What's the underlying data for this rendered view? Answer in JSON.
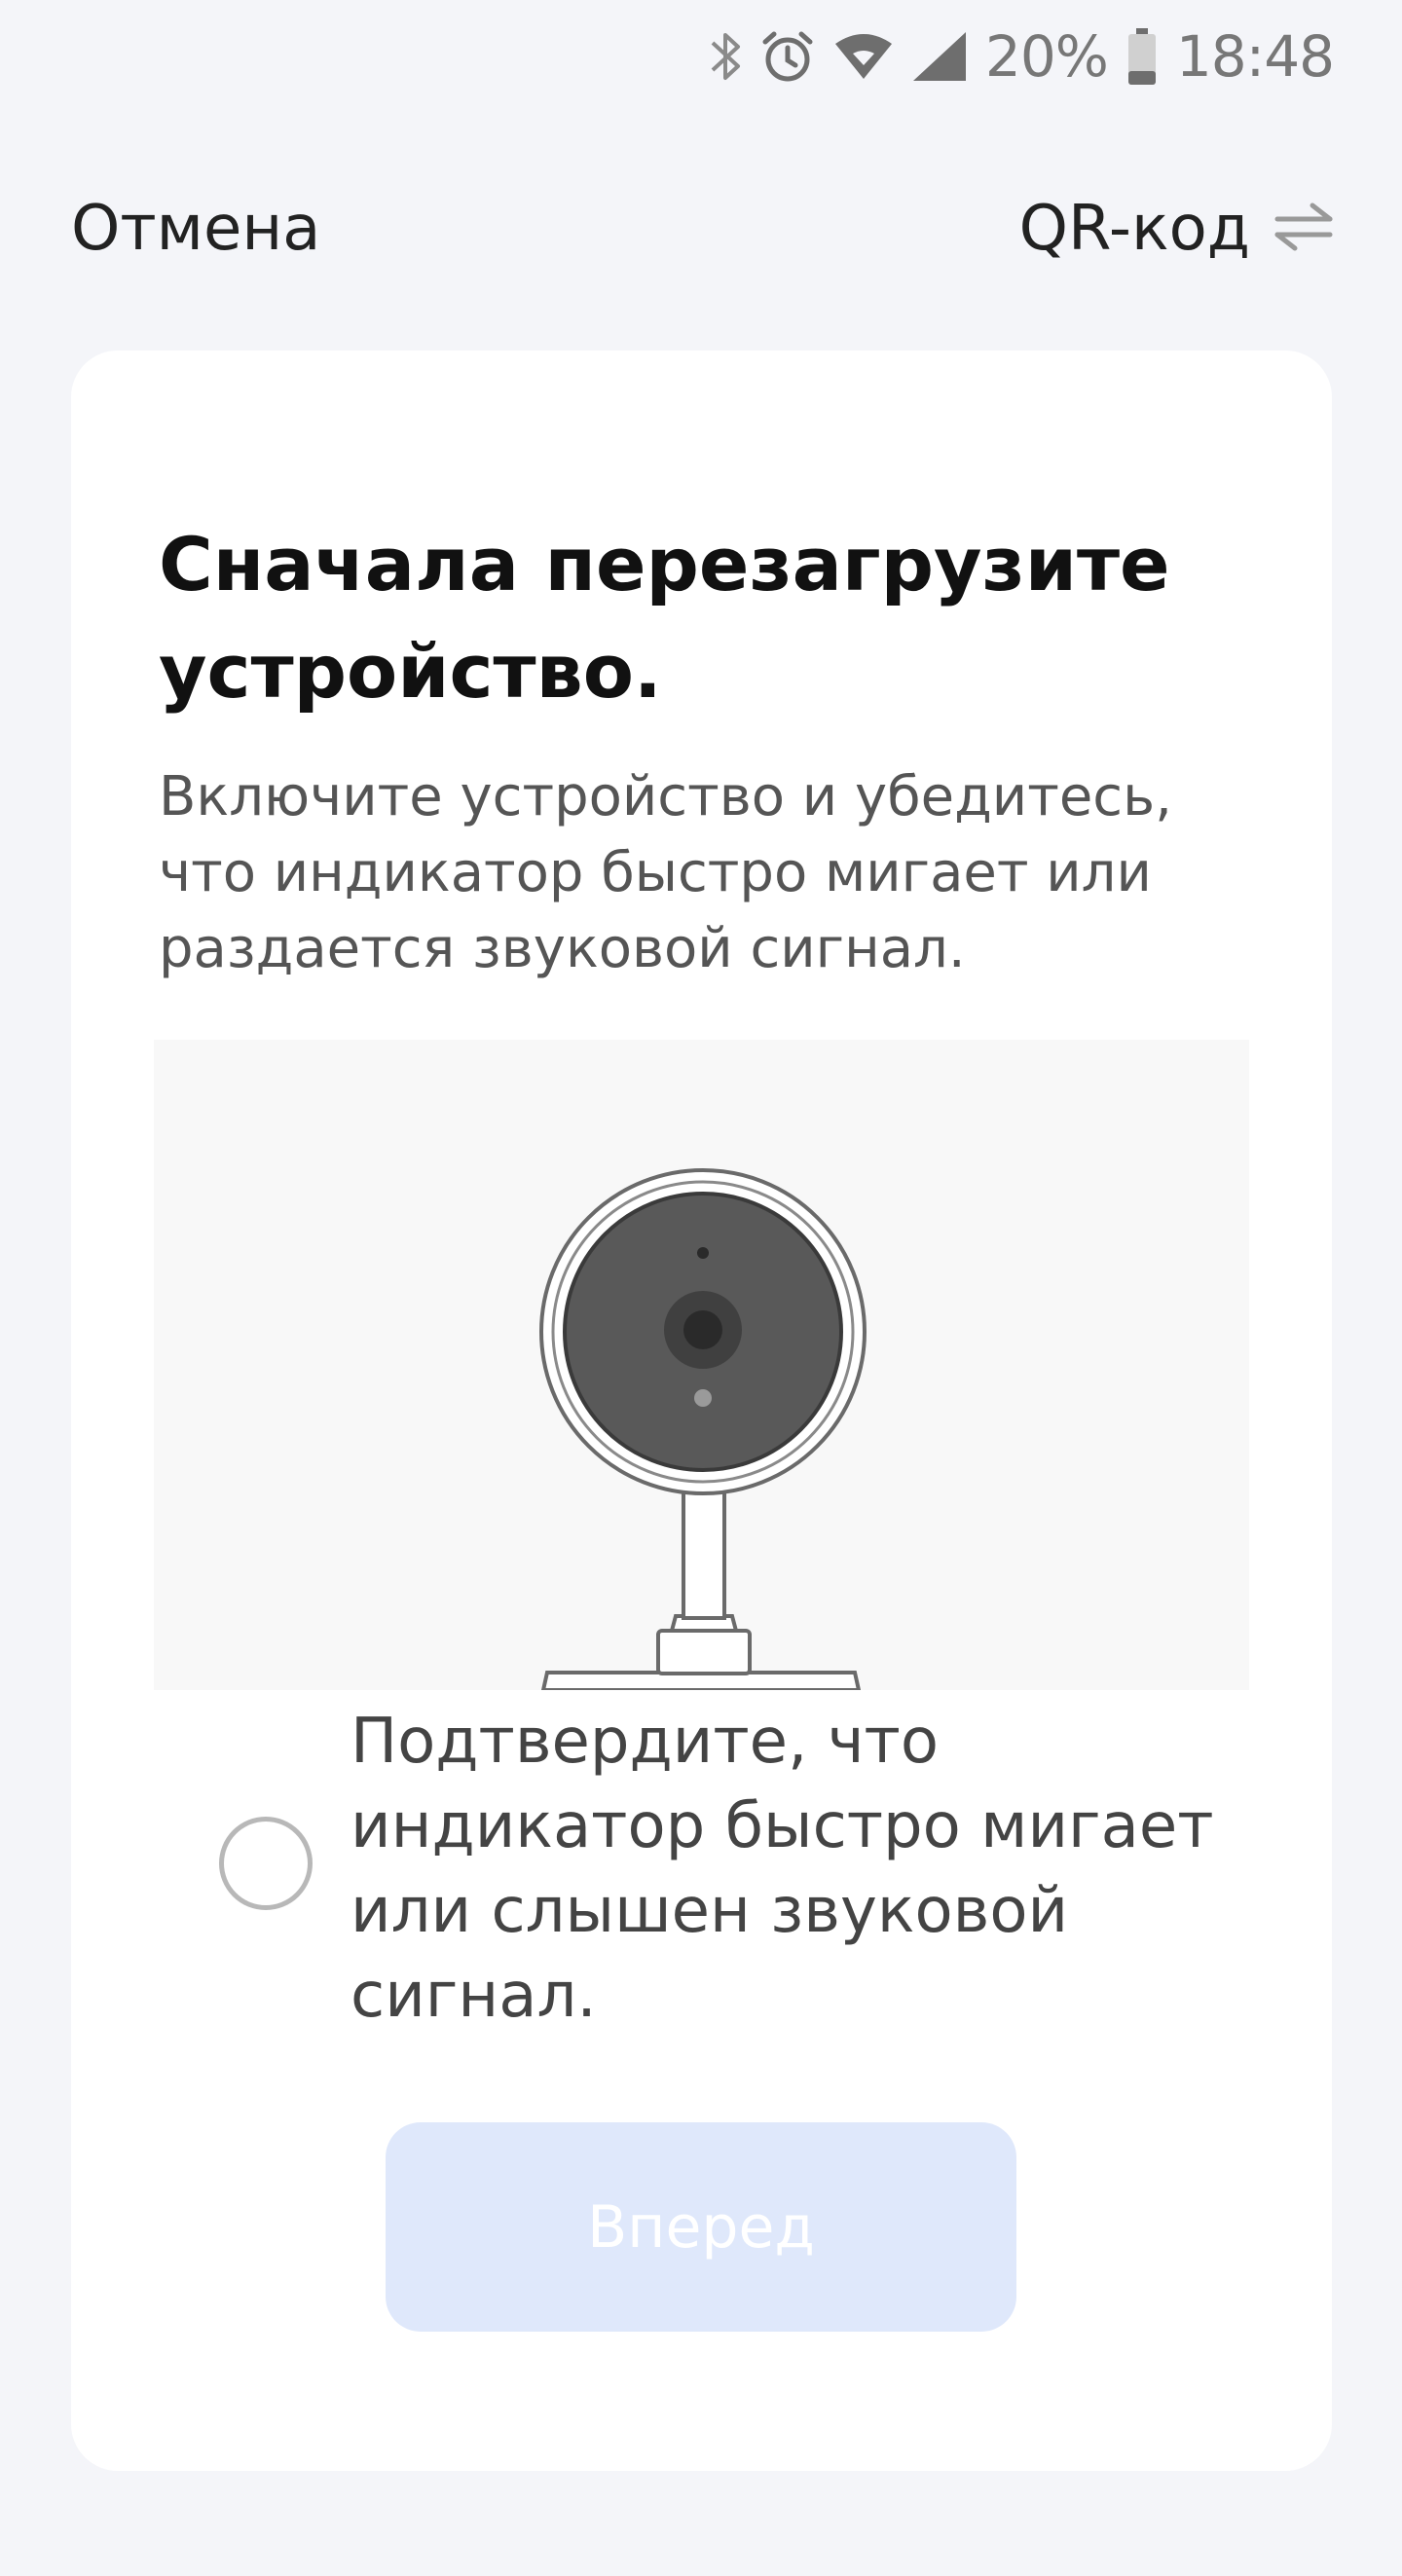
{
  "status_bar": {
    "battery_percent": "20%",
    "time": "18:48",
    "icons": [
      "bluetooth-icon",
      "alarm-icon",
      "wifi-icon",
      "cell-signal-icon",
      "battery-icon"
    ]
  },
  "nav": {
    "cancel_label": "Отмена",
    "qr_label": "QR-код",
    "qr_icon": "switch-arrows-icon"
  },
  "card": {
    "title": "Сначала перезагрузите устройство.",
    "description": "Включите устройство и убедитесь, что индикатор быстро мигает или раздается звуковой сигнал.",
    "illustration_icon": "camera-illustration",
    "confirm": {
      "checked": false,
      "label": "Подтвердите, что индикатор быстро мигает или слышен звуковой сигнал."
    },
    "next_button_label": "Вперед"
  },
  "colors": {
    "page_background": "#f4f5f9",
    "card_background": "#ffffff",
    "button_disabled": "#dfe8fb",
    "illustration_background": "#f8f8f8"
  }
}
